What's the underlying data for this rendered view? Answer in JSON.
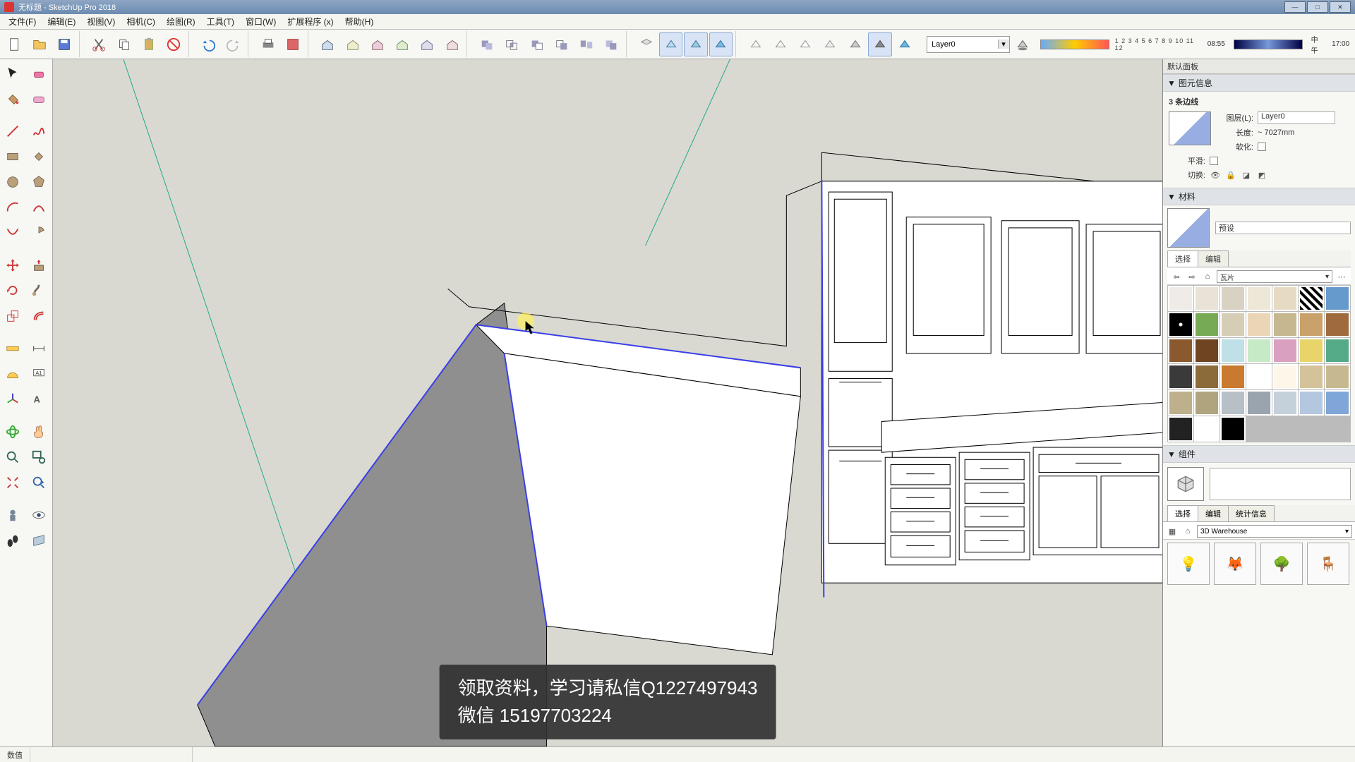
{
  "title": "无标题 - SketchUp Pro 2018",
  "menu": [
    "文件(F)",
    "编辑(E)",
    "视图(V)",
    "相机(C)",
    "绘图(R)",
    "工具(T)",
    "窗口(W)",
    "扩展程序 (x)",
    "帮助(H)"
  ],
  "layer_selected": "Layer0",
  "shadow_numbers": "1 2 3 4 5 6 7 8 9 10 11 12",
  "shadow_time_left": "08:55",
  "shadow_mid": "中午",
  "shadow_time_right": "17:00",
  "tray_title": "默认面板",
  "sections": {
    "entity": {
      "title": "图元信息",
      "sub": "3 条边线",
      "layer_label": "图层(L):",
      "layer_value": "Layer0",
      "length_label": "长度:",
      "length_value": "~ 7027mm",
      "soften_label": "软化:",
      "smooth_label": "平滑:",
      "toggle_label": "切换:"
    },
    "materials": {
      "title": "材料",
      "current": "预设",
      "tabs": [
        "选择",
        "编辑"
      ],
      "lib": "瓦片"
    },
    "components": {
      "title": "组件",
      "tabs": [
        "选择",
        "编辑",
        "统计信息"
      ],
      "lib": "3D Warehouse"
    }
  },
  "status_measure_label": "数值",
  "subtitle_line1": "领取资料，学习请私信Q1227497943",
  "subtitle_line2": "微信 15197703224"
}
